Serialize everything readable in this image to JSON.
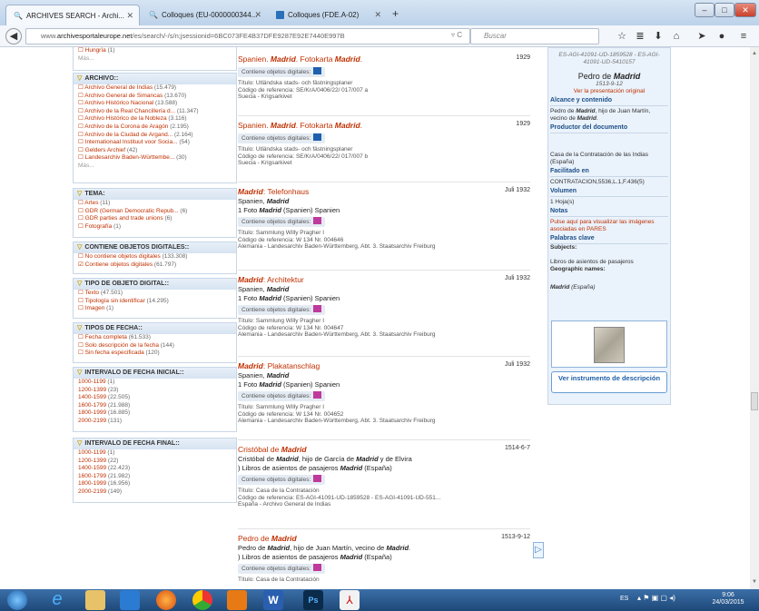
{
  "tabs": [
    {
      "label": "ARCHIVES SEARCH - Archi..."
    },
    {
      "label": "Colloques (EU-0000000344..."
    },
    {
      "label": "Colloques (FDE.A-02)"
    }
  ],
  "nav": {
    "url_prefix": "www.",
    "url_domain": "archivesportaleurope.net",
    "url_rest": "/es/search/-/s/n;jsessionid=6BC073FE4B37DFE9287E92E7440E997B",
    "search_placeholder": "Buscar"
  },
  "sidebar": {
    "top_items": [
      {
        "label": "Hungría",
        "count": "(1)"
      }
    ],
    "top_more": "Más...",
    "archivo": {
      "title": "ARCHIVO::",
      "items": [
        {
          "label": "Archivo General de Indias",
          "count": "(15.479)"
        },
        {
          "label": "Archivo General de Simancas",
          "count": "(13.670)"
        },
        {
          "label": "Archivo Histórico Nacional",
          "count": "(13.588)"
        },
        {
          "label": "Archivo de la Real Chancillería d...",
          "count": "(11.347)"
        },
        {
          "label": "Archivo Histórico de la Nobleza",
          "count": "(3.116)"
        },
        {
          "label": "Archivo de la Corona de Aragón",
          "count": "(2.195)"
        },
        {
          "label": "Archivo de la Ciudad de Argand...",
          "count": "(2.164)"
        },
        {
          "label": "Internationaal Instituut voor Socia...",
          "count": "(54)"
        },
        {
          "label": "Gelders Archief",
          "count": "(42)"
        },
        {
          "label": "Landesarchiv Baden-Württembe...",
          "count": "(30)"
        }
      ],
      "more": "Más..."
    },
    "tema": {
      "title": "TEMA:",
      "items": [
        {
          "label": "Artes",
          "count": "(11)"
        },
        {
          "label": "GDR (German Democratic Repub...",
          "count": "(6)"
        },
        {
          "label": "GDR parties and trade unions",
          "count": "(6)"
        },
        {
          "label": "Fotografía",
          "count": "(1)"
        }
      ]
    },
    "digital": {
      "title": "CONTIENE OBJETOS DIGITALES::",
      "items": [
        {
          "label": "No contiene objetos digitales",
          "count": "(133.308)"
        },
        {
          "label": "Contiene objetos digitales",
          "count": "(61.797)"
        }
      ]
    },
    "tipo": {
      "title": "TIPO DE OBJETO DIGITAL::",
      "items": [
        {
          "label": "Texto",
          "count": "(47.501)"
        },
        {
          "label": "Tipología sin identificar",
          "count": "(14.295)"
        },
        {
          "label": "Imagen",
          "count": "(1)"
        }
      ]
    },
    "fecha": {
      "title": "TIPOS DE FECHA::",
      "items": [
        {
          "label": "Fecha completa",
          "count": "(61.533)"
        },
        {
          "label": "Solo descripción de la fecha",
          "count": "(144)"
        },
        {
          "label": "Sin fecha especificada",
          "count": "(120)"
        }
      ]
    },
    "inicial": {
      "title": "INTERVALO DE FECHA INICIAL::",
      "items": [
        {
          "label": "1000-1199",
          "count": "(1)"
        },
        {
          "label": "1200-1399",
          "count": "(23)"
        },
        {
          "label": "1400-1599",
          "count": "(22.505)"
        },
        {
          "label": "1600-1799",
          "count": "(21.988)"
        },
        {
          "label": "1800-1999",
          "count": "(16.885)"
        },
        {
          "label": "2000-2199",
          "count": "(131)"
        }
      ]
    },
    "final": {
      "title": "INTERVALO DE FECHA FINAL::",
      "items": [
        {
          "label": "1000-1199",
          "count": "(1)"
        },
        {
          "label": "1200-1399",
          "count": "(22)"
        },
        {
          "label": "1400-1599",
          "count": "(22.423)"
        },
        {
          "label": "1600-1799",
          "count": "(21.982)"
        },
        {
          "label": "1800-1999",
          "count": "(16.956)"
        },
        {
          "label": "2000-2199",
          "count": "(149)"
        }
      ]
    }
  },
  "results": [
    {
      "title": "Spanien. Madrid. Fotokarta Madrid.",
      "date": "1929",
      "sub1": "",
      "sub2": "",
      "digital": "Contiene objetos digitales:",
      "m1": "Título: Utländska stads- och fästningsplaner",
      "m2": "Código de referencia: SE/KrA/0406/22/ 017/007 a",
      "m3": "Suecia - Krigsarkivet"
    },
    {
      "title": "Spanien. Madrid. Fotokarta Madrid.",
      "date": "1929",
      "sub1": "",
      "sub2": "",
      "digital": "Contiene objetos digitales:",
      "m1": "Título: Utländska stads- och fästningsplaner",
      "m2": "Código de referencia: SE/KrA/0406/22/ 017/007 b",
      "m3": "Suecia - Krigsarkivet"
    },
    {
      "title": "Madrid: Telefonhaus",
      "date": "Juli 1932",
      "sub1": "Spanien, Madrid",
      "sub2": "1 Foto Madrid (Spanien) Spanien",
      "digital": "Contiene objetos digitales:",
      "m1": "Título: Sammlung Willy Pragher I",
      "m2": "Código de referencia: W 134 Nr. 004646",
      "m3": "Alemania - Landesarchiv Baden-Württemberg, Abt. 3. Staatsarchiv Freiburg"
    },
    {
      "title": "Madrid: Architektur",
      "date": "Juli 1932",
      "sub1": "Spanien, Madrid",
      "sub2": "1 Foto Madrid (Spanien) Spanien",
      "digital": "Contiene objetos digitales:",
      "m1": "Título: Sammlung Willy Pragher I",
      "m2": "Código de referencia: W 134 Nr. 004647",
      "m3": "Alemania - Landesarchiv Baden-Württemberg, Abt. 3. Staatsarchiv Freiburg"
    },
    {
      "title": "Madrid: Plakatanschlag",
      "date": "Juli 1932",
      "sub1": "Spanien, Madrid",
      "sub2": "1 Foto Madrid (Spanien) Spanien",
      "digital": "Contiene objetos digitales:",
      "m1": "Título: Sammlung Willy Pragher I",
      "m2": "Código de referencia: W 134 Nr. 004652",
      "m3": "Alemania - Landesarchiv Baden-Württemberg, Abt. 3. Staatsarchiv Freiburg"
    },
    {
      "title": "Cristóbal de Madrid",
      "date": "1514-6-7",
      "sub1": "Cristóbal de Madrid, hijo de García de Madrid y de Elvira",
      "sub2": ") Libros de asientos de pasajeros Madrid (España)",
      "digital": "Contiene objetos digitales:",
      "m1": "Título: Casa de la Contratación",
      "m2": "Código de referencia: ES-AGI-41091-UD-1859528 - ES-AGI-41091-UD-551...",
      "m3": "España - Archivo General de Indias"
    },
    {
      "title": "Pedro de Madrid",
      "date": "1513-9-12",
      "sub1": "Pedro de Madrid, hijo de Juan Martín, vecino de Madrid.",
      "sub2": ") Libros de asientos de pasajeros Madrid (España)",
      "digital": "Contiene objetos digitales:",
      "m1": "Título: Casa de la Contratación",
      "m2": "",
      "m3": ""
    }
  ],
  "panel": {
    "ref": "ES-AGI-41091-UD-1859528 - ES-AGI-41091-UD-5410157",
    "name": "Pedro de Madrid",
    "date": "1513-9-12",
    "view_original": "Ver la presentación original",
    "h_alcance": "Alcance y contenido",
    "alcance": "Pedro de Madrid, hijo de Juan Martín, vecino de Madrid.",
    "h_productor": "Productor del documento",
    "productor": "Casa de la Contratación de las Indias (España)",
    "h_facilitado": "Facilitado en",
    "facilitado": "CONTRATACION,5536,L.1,F.436(5)",
    "h_volumen": "Volumen",
    "volumen": "1 Hoja(s)",
    "h_notas": "Notas",
    "notas": "Pulse aquí para visualizar las imágenes asociadas en PARES",
    "h_palabras": "Palabras clave",
    "subjects": "Subjects:",
    "subjects_val": "Libros de asientos de pasajeros",
    "geo": "Geographic names:",
    "geo_val": "Madrid (España)",
    "button": "Ver instrumento de descripción"
  },
  "taskbar": {
    "lang": "ES",
    "time": "9:06",
    "date": "24/03/2015"
  }
}
